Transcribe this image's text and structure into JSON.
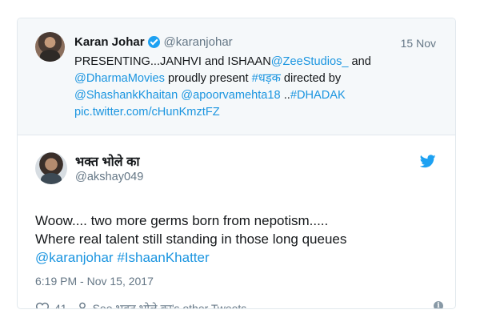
{
  "quoted": {
    "name": "Karan Johar",
    "handle": "@karanjohar",
    "date": "15 Nov",
    "text_part1": "PRESENTING...JANHVI and ISHAAN",
    "mention_zee": "@ZeeStudios_",
    "text_part2": " and",
    "mention_dharma": "@DharmaMovies",
    "text_part3": " proudly present ",
    "hashtag_dhadak_hindi": "#धड़क",
    "text_part4": " directed by",
    "mention_shashank": "@ShashankKhaitan",
    "space": " ",
    "mention_apoorva": "@apoorvamehta18",
    "text_part5": " ..",
    "hashtag_dhadak": "#DHADAK",
    "pic_link": "pic.twitter.com/cHunKmztFZ"
  },
  "tweet": {
    "name": "भक्त भोले का",
    "handle": "@akshay049",
    "line1": "Woow....  two more germs born from nepotism.....",
    "line2": "Where real talent still standing in those long queues",
    "mention": "@karanjohar",
    "hashtag": "#IshaanKhatter",
    "timestamp": "6:19 PM - Nov 15, 2017"
  },
  "actions": {
    "likes": "41",
    "other_tweets": "See भक्त भोले का's other Tweets"
  },
  "icons": {
    "verified": "verified-badge-icon",
    "bird": "twitter-bird-icon",
    "heart": "heart-icon",
    "person": "person-icon",
    "info": "info-icon"
  },
  "colors": {
    "link": "#1b95e0",
    "twitter_blue": "#1da1f2",
    "muted": "#657786",
    "quoted_bg": "#f5f8fa"
  }
}
